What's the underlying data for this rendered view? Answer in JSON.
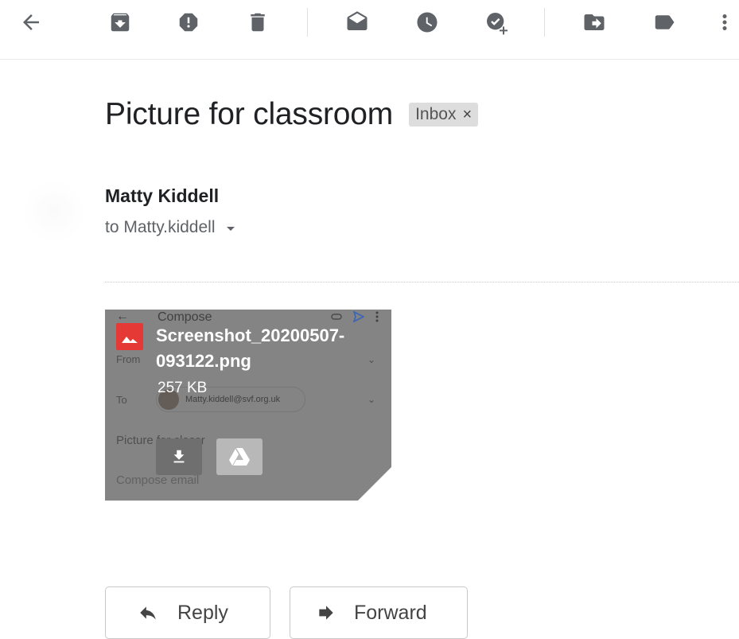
{
  "toolbar": {
    "items": [
      {
        "icon": "back-arrow-icon"
      },
      {
        "icon": "archive-icon"
      },
      {
        "icon": "report-spam-icon"
      },
      {
        "icon": "delete-icon"
      },
      {
        "icon": "mark-unread-icon"
      },
      {
        "icon": "snooze-icon"
      },
      {
        "icon": "add-to-tasks-icon"
      },
      {
        "icon": "move-to-icon"
      },
      {
        "icon": "label-icon"
      },
      {
        "icon": "more-options-icon"
      }
    ]
  },
  "message": {
    "subject": "Picture for classroom",
    "label": "Inbox",
    "label_remove": "×",
    "sender": "Matty Kiddell",
    "recipient": "to Matty.kiddell"
  },
  "attachment": {
    "filename": "Screenshot_20200507-093122.png",
    "size": "257 KB",
    "preview": {
      "title": "Compose",
      "from_label": "From",
      "to_label": "To",
      "to_email": "Matty.kiddell@svf.org.uk",
      "subject_partial": "Picture for classr",
      "body_placeholder": "Compose email"
    }
  },
  "actions": {
    "reply": "Reply",
    "forward": "Forward"
  },
  "colors": {
    "icon": "#5f6368",
    "attachment_type": "#e53935",
    "label_bg": "#dddddd"
  }
}
